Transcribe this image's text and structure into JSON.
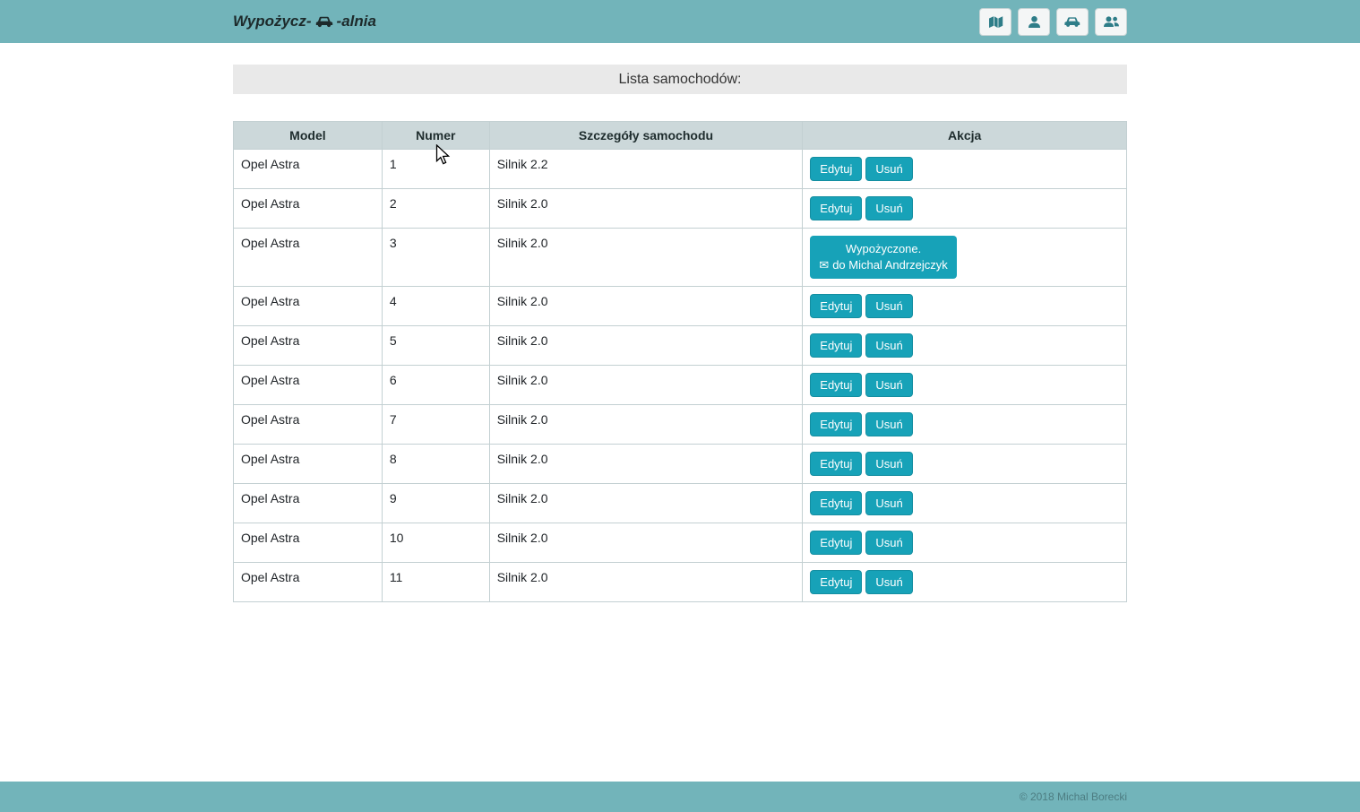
{
  "header": {
    "brand": {
      "prefix": "Wypożycz-",
      "suffix": "-alnia"
    },
    "nav_icons": [
      {
        "name": "map-icon"
      },
      {
        "name": "user-icon"
      },
      {
        "name": "car-icon"
      },
      {
        "name": "users-icon"
      }
    ]
  },
  "banner": {
    "title": "Lista samochodów:"
  },
  "table": {
    "headers": [
      "Model",
      "Numer",
      "Szczegóły samochodu",
      "Akcja"
    ],
    "actions": {
      "edit": "Edytuj",
      "delete": "Usuń"
    },
    "rented": {
      "line1": "Wypożyczone.",
      "line2": "do Michal Andrzejczyk",
      "envelope_glyph": "✉"
    },
    "rows": [
      {
        "model": "Opel Astra",
        "numer": "1",
        "details": "Silnik 2.2",
        "rented": false
      },
      {
        "model": "Opel Astra",
        "numer": "2",
        "details": "Silnik 2.0",
        "rented": false
      },
      {
        "model": "Opel Astra",
        "numer": "3",
        "details": "Silnik 2.0",
        "rented": true
      },
      {
        "model": "Opel Astra",
        "numer": "4",
        "details": "Silnik 2.0",
        "rented": false
      },
      {
        "model": "Opel Astra",
        "numer": "5",
        "details": "Silnik 2.0",
        "rented": false
      },
      {
        "model": "Opel Astra",
        "numer": "6",
        "details": "Silnik 2.0",
        "rented": false
      },
      {
        "model": "Opel Astra",
        "numer": "7",
        "details": "Silnik 2.0",
        "rented": false
      },
      {
        "model": "Opel Astra",
        "numer": "8",
        "details": "Silnik 2.0",
        "rented": false
      },
      {
        "model": "Opel Astra",
        "numer": "9",
        "details": "Silnik 2.0",
        "rented": false
      },
      {
        "model": "Opel Astra",
        "numer": "10",
        "details": "Silnik 2.0",
        "rented": false
      },
      {
        "model": "Opel Astra",
        "numer": "11",
        "details": "Silnik 2.0",
        "rented": false
      }
    ]
  },
  "footer": {
    "copyright": "© 2018 Michal Borecki"
  },
  "colors": {
    "accent": "#17a2b8",
    "bar_bg": "#72b4ba",
    "table_head_bg": "#ccd8da",
    "banner_bg": "#e9e9e9"
  }
}
